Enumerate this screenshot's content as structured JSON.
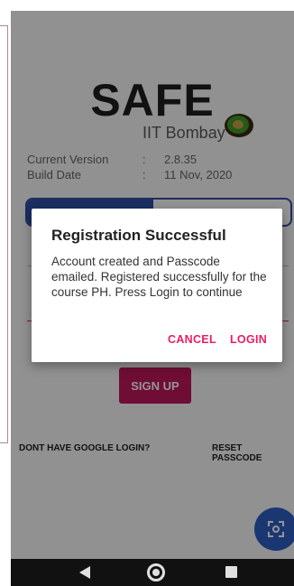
{
  "app": {
    "title": "SAFE",
    "subtitle": "IIT Bombay"
  },
  "info": {
    "version_label": "Current Version",
    "version_sep": ":",
    "version_value": "2.8.35",
    "build_label": "Build Date",
    "build_sep": ":",
    "build_value": "11 Nov, 2020"
  },
  "actions": {
    "signup_label": "SIGN UP",
    "no_google_login": "DONT HAVE GOOGLE LOGIN?",
    "reset_passcode": "RESET PASSCODE"
  },
  "dialog": {
    "title": "Registration Successful",
    "message": "Account created and Passcode emailed. Registered successfully for the course PH. Press Login to continue",
    "cancel": "CANCEL",
    "login": "LOGIN"
  },
  "colors": {
    "primary": "#2f4fa8",
    "accent": "#e91e63",
    "signup": "#c2185b"
  },
  "icons": {
    "fab": "scan-icon",
    "logo": "kiwi-icon",
    "nav": [
      "back-icon",
      "home-icon",
      "recents-icon"
    ]
  }
}
